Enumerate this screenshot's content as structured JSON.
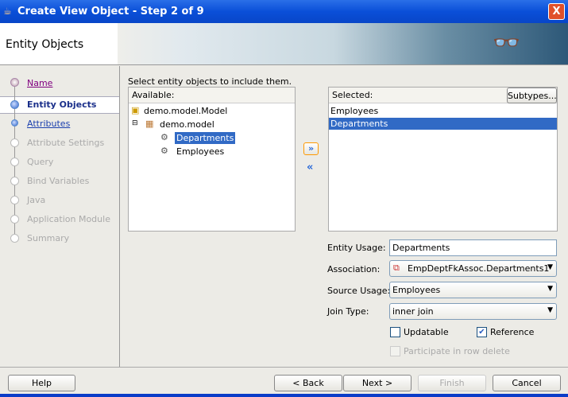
{
  "window": {
    "title": "Create View Object - Step 2 of 9",
    "close": "X"
  },
  "banner": {
    "heading": "Entity Objects"
  },
  "steps": [
    {
      "label": "Name",
      "state": "visited"
    },
    {
      "label": "Entity Objects",
      "state": "current"
    },
    {
      "label": "Attributes",
      "state": "link"
    },
    {
      "label": "Attribute Settings",
      "state": "disabled"
    },
    {
      "label": "Query",
      "state": "disabled"
    },
    {
      "label": "Bind Variables",
      "state": "disabled"
    },
    {
      "label": "Java",
      "state": "disabled"
    },
    {
      "label": "Application Module",
      "state": "disabled"
    },
    {
      "label": "Summary",
      "state": "disabled"
    }
  ],
  "main": {
    "instruction": "Select entity objects to include them.",
    "available_label": "Available:",
    "tree": {
      "root": "demo.model.Model",
      "package": "demo.model",
      "children": [
        "Departments",
        "Employees"
      ],
      "selected": "Departments"
    },
    "shuttle_add": "»",
    "shuttle_remove": "«",
    "selected_label": "Selected:",
    "subtypes_button": "Subtypes...",
    "selected_items": [
      "Employees",
      "Departments"
    ],
    "entity_usage_label": "Entity Usage:",
    "entity_usage": "Departments",
    "association_label": "Association:",
    "association": "EmpDeptFkAssoc.Departments1",
    "source_usage_label": "Source Usage:",
    "source_usage": "Employees",
    "join_type_label": "Join Type:",
    "join_type": "inner join",
    "updatable_label": "Updatable",
    "updatable": false,
    "reference_label": "Reference",
    "reference": true,
    "participate_label": "Participate in row delete",
    "participate": false
  },
  "footer": {
    "help": "Help",
    "back": "< Back",
    "next": "Next >",
    "finish": "Finish",
    "cancel": "Cancel"
  }
}
